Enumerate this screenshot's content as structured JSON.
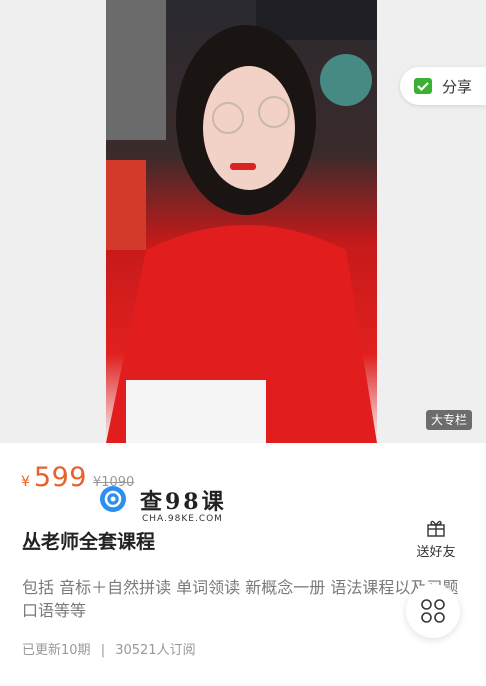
{
  "hero": {
    "badge": "大专栏"
  },
  "share": {
    "label": "分享",
    "icon": "wechat-icon"
  },
  "pricing": {
    "currency": "¥",
    "price": "599",
    "original_price": "¥1090",
    "price_color": "#e8612a"
  },
  "watermark": {
    "text": "查98课",
    "sub": "CHA.98KE.COM"
  },
  "course": {
    "title": "丛老师全套课程",
    "description": "包括 音标＋自然拼读 单词领读 新概念一册 语法课程以及习题口语等等",
    "updated": "已更新10期",
    "separator": "|",
    "subscribers": "30521人订阅"
  },
  "gift": {
    "label": "送好友",
    "icon": "gift-icon"
  },
  "fab": {
    "icon": "grid-clover-icon"
  }
}
